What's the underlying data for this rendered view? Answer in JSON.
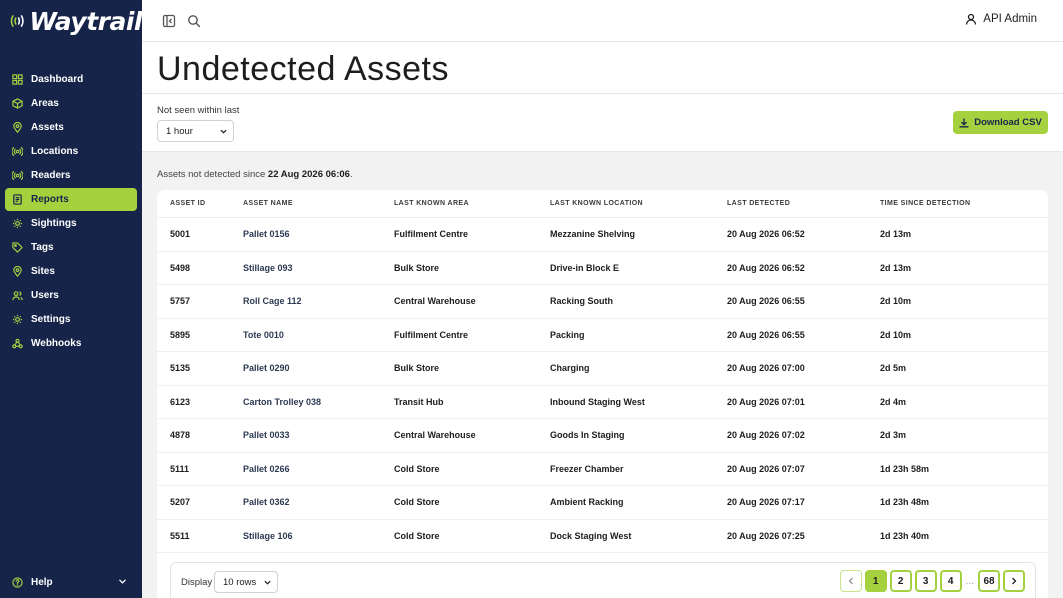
{
  "brand": {
    "name": "Waytrail",
    "accent": "#a5d13f",
    "sidebar_bg": "#16244a"
  },
  "sidebar": {
    "items": [
      {
        "label": "Dashboard",
        "icon": "grid-icon"
      },
      {
        "label": "Areas",
        "icon": "cube-icon"
      },
      {
        "label": "Assets",
        "icon": "pin-icon"
      },
      {
        "label": "Locations",
        "icon": "broadcast-icon"
      },
      {
        "label": "Readers",
        "icon": "broadcast-icon"
      },
      {
        "label": "Reports",
        "icon": "report-icon",
        "active": true
      },
      {
        "label": "Sightings",
        "icon": "gear-icon"
      },
      {
        "label": "Tags",
        "icon": "tag-icon"
      },
      {
        "label": "Sites",
        "icon": "pin-icon"
      },
      {
        "label": "Users",
        "icon": "users-icon"
      },
      {
        "label": "Settings",
        "icon": "gear-icon"
      },
      {
        "label": "Webhooks",
        "icon": "webhook-icon"
      }
    ],
    "help_label": "Help"
  },
  "topbar": {
    "user_name": "API Admin"
  },
  "page": {
    "title": "Undetected Assets",
    "filter_label": "Not seen within last",
    "filter_value": "1 hour",
    "download_label": "Download CSV",
    "since_prefix": "Assets not detected since",
    "since_date": "22 Aug 2026 06:06",
    "since_suffix": "."
  },
  "table": {
    "columns": [
      "Asset ID",
      "Asset Name",
      "Last Known Area",
      "Last Known Location",
      "Last Detected",
      "Time Since Detection"
    ],
    "rows": [
      [
        "5001",
        "Pallet 0156",
        "Fulfilment Centre",
        "Mezzanine Shelving",
        "20 Aug 2026 06:52",
        "2d 13m"
      ],
      [
        "5498",
        "Stillage 093",
        "Bulk Store",
        "Drive-in Block E",
        "20 Aug 2026 06:52",
        "2d 13m"
      ],
      [
        "5757",
        "Roll Cage 112",
        "Central Warehouse",
        "Racking South",
        "20 Aug 2026 06:55",
        "2d 10m"
      ],
      [
        "5895",
        "Tote 0010",
        "Fulfilment Centre",
        "Packing",
        "20 Aug 2026 06:55",
        "2d 10m"
      ],
      [
        "5135",
        "Pallet 0290",
        "Bulk Store",
        "Charging",
        "20 Aug 2026 07:00",
        "2d 5m"
      ],
      [
        "6123",
        "Carton Trolley 038",
        "Transit Hub",
        "Inbound Staging West",
        "20 Aug 2026 07:01",
        "2d 4m"
      ],
      [
        "4878",
        "Pallet 0033",
        "Central Warehouse",
        "Goods In Staging",
        "20 Aug 2026 07:02",
        "2d 3m"
      ],
      [
        "5111",
        "Pallet 0266",
        "Cold Store",
        "Freezer Chamber",
        "20 Aug 2026 07:07",
        "1d 23h 58m"
      ],
      [
        "5207",
        "Pallet 0362",
        "Cold Store",
        "Ambient Racking",
        "20 Aug 2026 07:17",
        "1d 23h 48m"
      ],
      [
        "5511",
        "Stillage 106",
        "Cold Store",
        "Dock Staging West",
        "20 Aug 2026 07:25",
        "1d 23h 40m"
      ]
    ]
  },
  "footer": {
    "display_label": "Display",
    "rows_value": "10 rows",
    "pages": [
      "1",
      "2",
      "3",
      "4"
    ],
    "ellipsis": "...",
    "last_page": "68",
    "current_page": "1"
  }
}
